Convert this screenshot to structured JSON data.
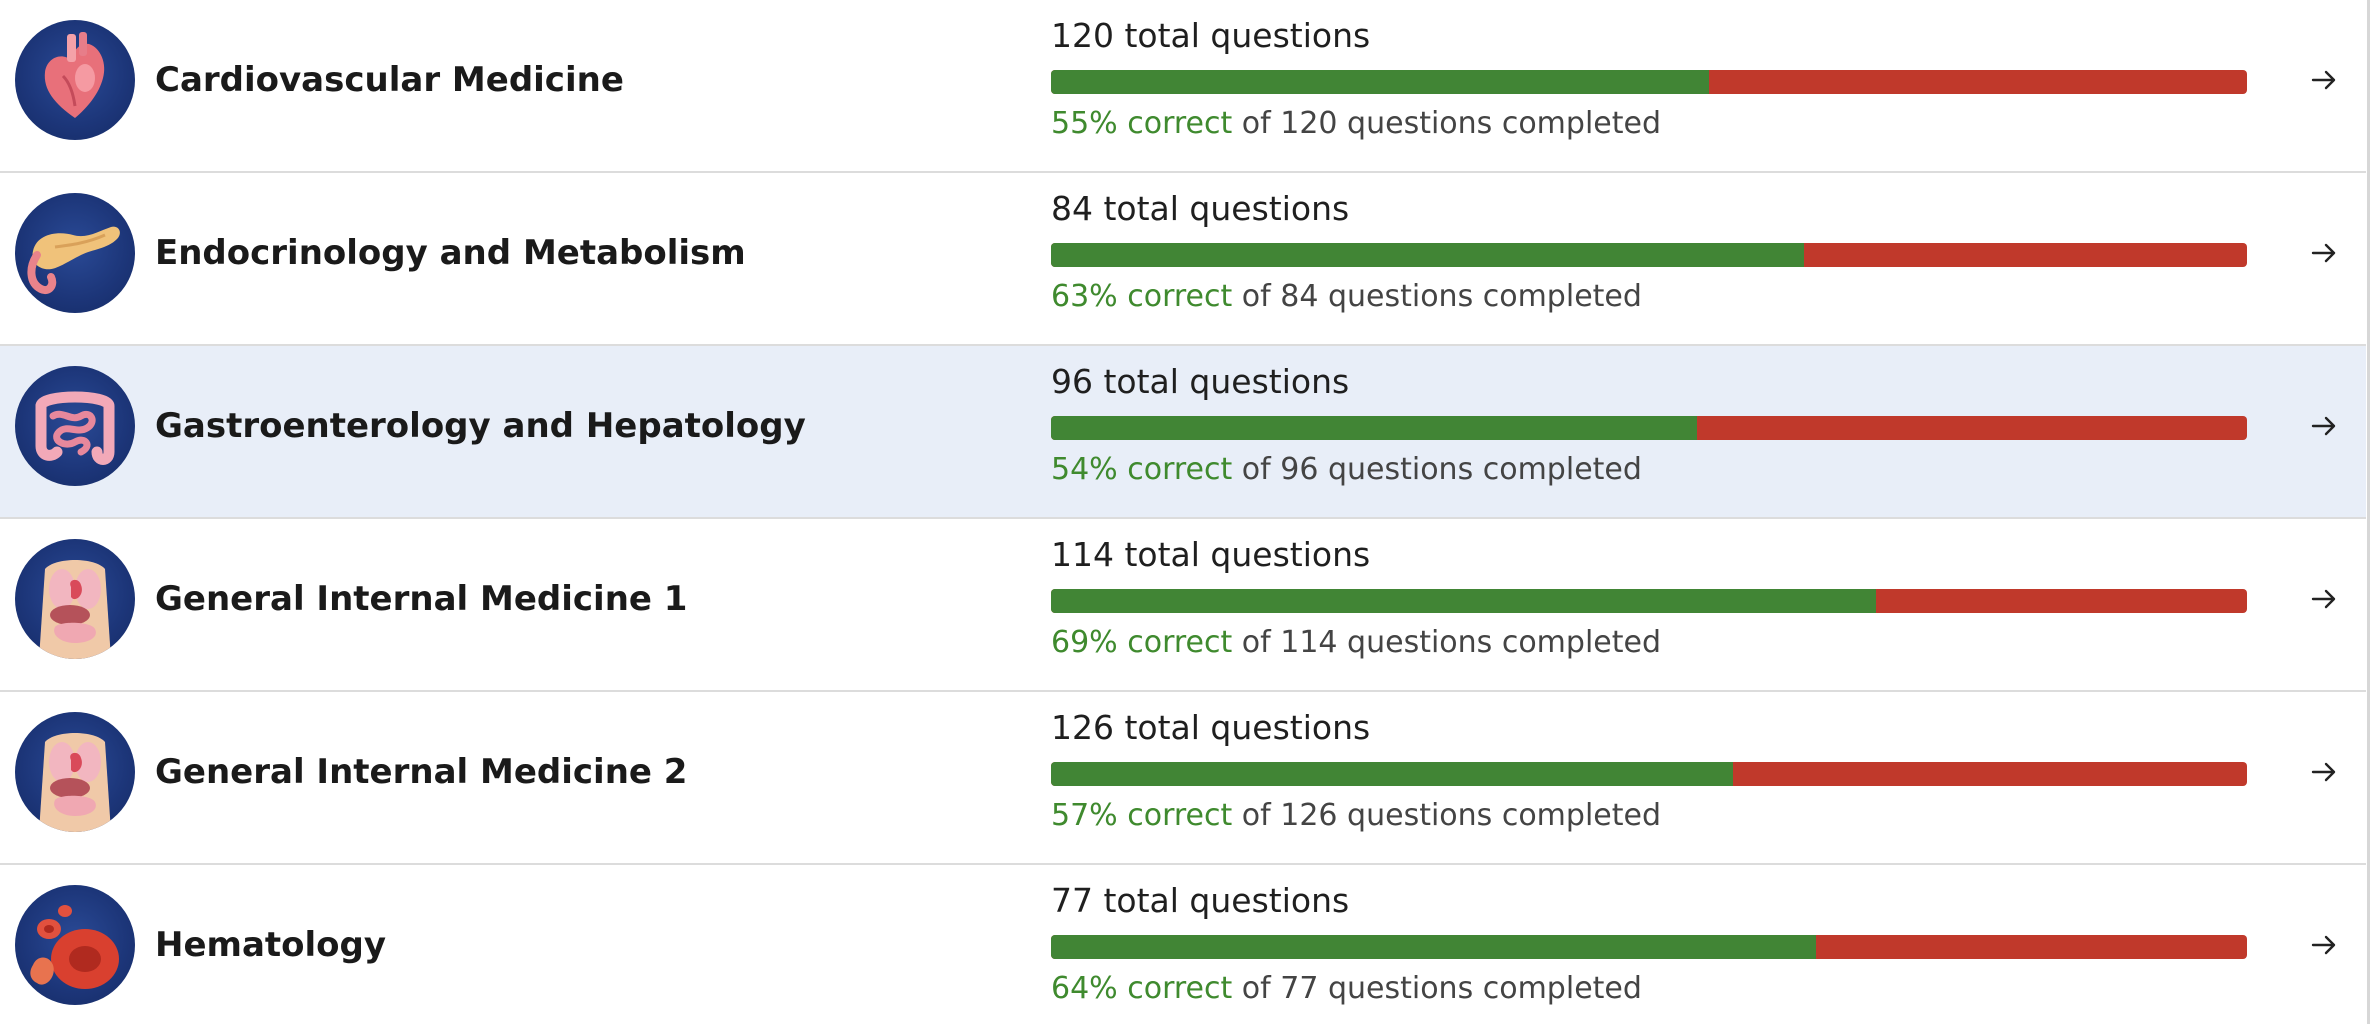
{
  "colors": {
    "correct": "#418535",
    "incorrect": "#c0392b",
    "correct_text": "#3f8a2e",
    "highlight_row": "#e8eef8",
    "icon_background": "#1c3578"
  },
  "topics": [
    {
      "icon": "heart-icon",
      "title": "Cardiovascular Medicine",
      "total": "120 total questions",
      "percent_label": "55% correct",
      "completed_label": " of 120 questions completed",
      "correct_fraction": 0.55
    },
    {
      "icon": "pancreas-icon",
      "title": "Endocrinology and Metabolism",
      "total": "84 total questions",
      "percent_label": "63% correct",
      "completed_label": " of 84 questions completed",
      "correct_fraction": 0.63
    },
    {
      "icon": "intestines-icon",
      "title": "Gastroenterology and Hepatology",
      "total": "96 total questions",
      "percent_label": "54% correct",
      "completed_label": " of 96 questions completed",
      "correct_fraction": 0.54
    },
    {
      "icon": "torso-organs-icon",
      "title": "General Internal Medicine 1",
      "total": "114 total questions",
      "percent_label": "69% correct",
      "completed_label": " of 114 questions completed",
      "correct_fraction": 0.69
    },
    {
      "icon": "torso-organs-icon",
      "title": "General Internal Medicine 2",
      "total": "126 total questions",
      "percent_label": "57% correct",
      "completed_label": " of 126 questions completed",
      "correct_fraction": 0.57
    },
    {
      "icon": "blood-cells-icon",
      "title": "Hematology",
      "total": "77 total questions",
      "percent_label": "64% correct",
      "completed_label": " of 77 questions completed",
      "correct_fraction": 0.64
    }
  ]
}
